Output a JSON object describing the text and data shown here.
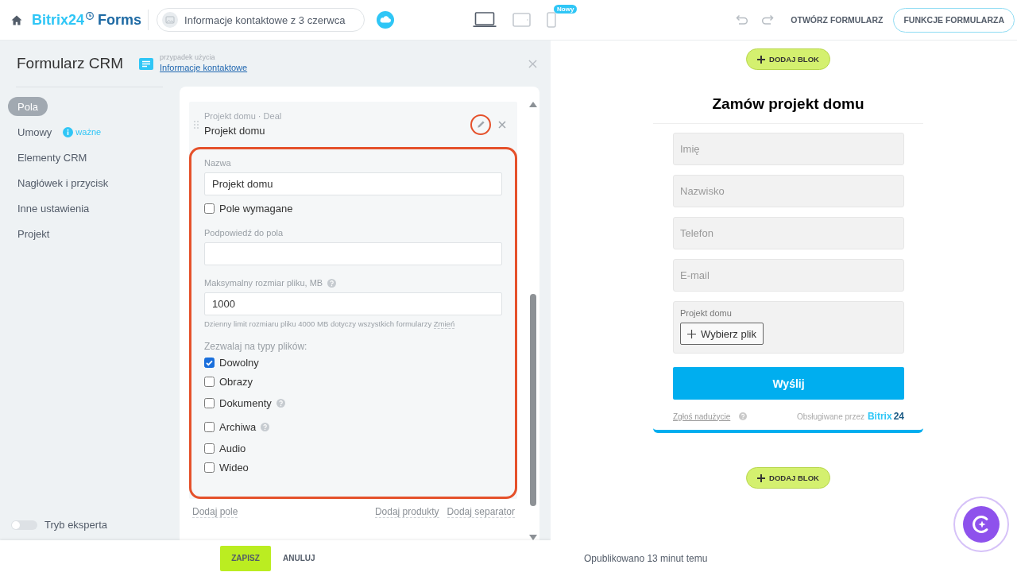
{
  "topbar": {
    "logo": {
      "brand": "Bitrix24",
      "product": "Forms"
    },
    "form_name": "Informacje kontaktowe z 3 czerwca",
    "devices": [
      {
        "kind": "desktop",
        "selected": true
      },
      {
        "kind": "tablet",
        "selected": false
      },
      {
        "kind": "mobile",
        "selected": false,
        "badge": "Nowy"
      }
    ],
    "actions": [
      {
        "kind": "link",
        "label": "OTWÓRZ FORMULARZ"
      },
      {
        "kind": "outline",
        "label": "FUNKCJE FORMULARZA"
      }
    ]
  },
  "panel": {
    "title": "Formularz CRM",
    "use_case": {
      "label": "przypadek użycia",
      "value": "Informacje kontaktowe"
    }
  },
  "sidebar": {
    "items": [
      {
        "label": "Pola",
        "selected": true
      },
      {
        "label": "Umowy",
        "selected": false,
        "tag": "ważne"
      },
      {
        "label": "Elementy CRM",
        "selected": false
      },
      {
        "label": "Nagłówek i przycisk",
        "selected": false
      },
      {
        "label": "Inne ustawienia",
        "selected": false
      },
      {
        "label": "Projekt",
        "selected": false
      }
    ],
    "expert_mode": {
      "label": "Tryb eksperta",
      "on": false
    }
  },
  "editor": {
    "field": {
      "subtitle": "Projekt domu · Deal",
      "title": "Projekt domu",
      "edit_highlighted": true
    },
    "settings": {
      "highlighted": true,
      "rows": [
        {
          "kind": "input",
          "label": "Nazwa",
          "help": false,
          "value": "Projekt domu"
        },
        {
          "kind": "checkbox",
          "label": "Pole wymagane",
          "checked": false
        },
        {
          "kind": "input",
          "label": "Podpowiedź do pola",
          "help": false
        },
        {
          "kind": "input",
          "label": "Maksymalny rozmiar pliku, MB",
          "help": true,
          "value": "1000",
          "hint": "Dzienny limit rozmiaru pliku 4000 MB dotyczy wszystkich formularzy",
          "hint_link": "Zmień"
        },
        {
          "kind": "checkbox_group",
          "label": "Zezwalaj na typy plików:",
          "options": [
            {
              "label": "Dowolny",
              "checked": true,
              "help": false
            },
            {
              "label": "Obrazy",
              "checked": false,
              "help": false
            },
            {
              "label": "Dokumenty",
              "checked": false,
              "help": true
            },
            {
              "label": "Archiwa",
              "checked": false,
              "help": true
            },
            {
              "label": "Audio",
              "checked": false,
              "help": false
            },
            {
              "label": "Wideo",
              "checked": false,
              "help": false
            }
          ]
        }
      ]
    },
    "add_field": "Dodaj pole",
    "add_more": [
      "Dodaj produkty",
      "Dodaj separator"
    ]
  },
  "footer": {
    "buttons": [
      {
        "kind": "primary",
        "label": "ZAPISZ"
      },
      {
        "kind": "plain",
        "label": "ANULUJ"
      }
    ]
  },
  "preview": {
    "add_block_top": "DODAJ BLOK",
    "form": {
      "title": "Zamów projekt domu",
      "fields": [
        {
          "kind": "text",
          "placeholder": "Imię"
        },
        {
          "kind": "text",
          "placeholder": "Nazwisko"
        },
        {
          "kind": "text",
          "placeholder": "Telefon"
        },
        {
          "kind": "text",
          "placeholder": "E-mail"
        },
        {
          "kind": "file",
          "label": "Projekt domu",
          "button": "Wybierz plik"
        }
      ],
      "submit": "Wyślij",
      "report_link": "Zgłoś nadużycie",
      "powered_by": "Obsługiwane przez",
      "brand": {
        "name": "Bitrix",
        "number": "24"
      }
    },
    "add_block_bottom": "DODAJ BLOK",
    "status": "Opublikowano 13 minut temu"
  }
}
